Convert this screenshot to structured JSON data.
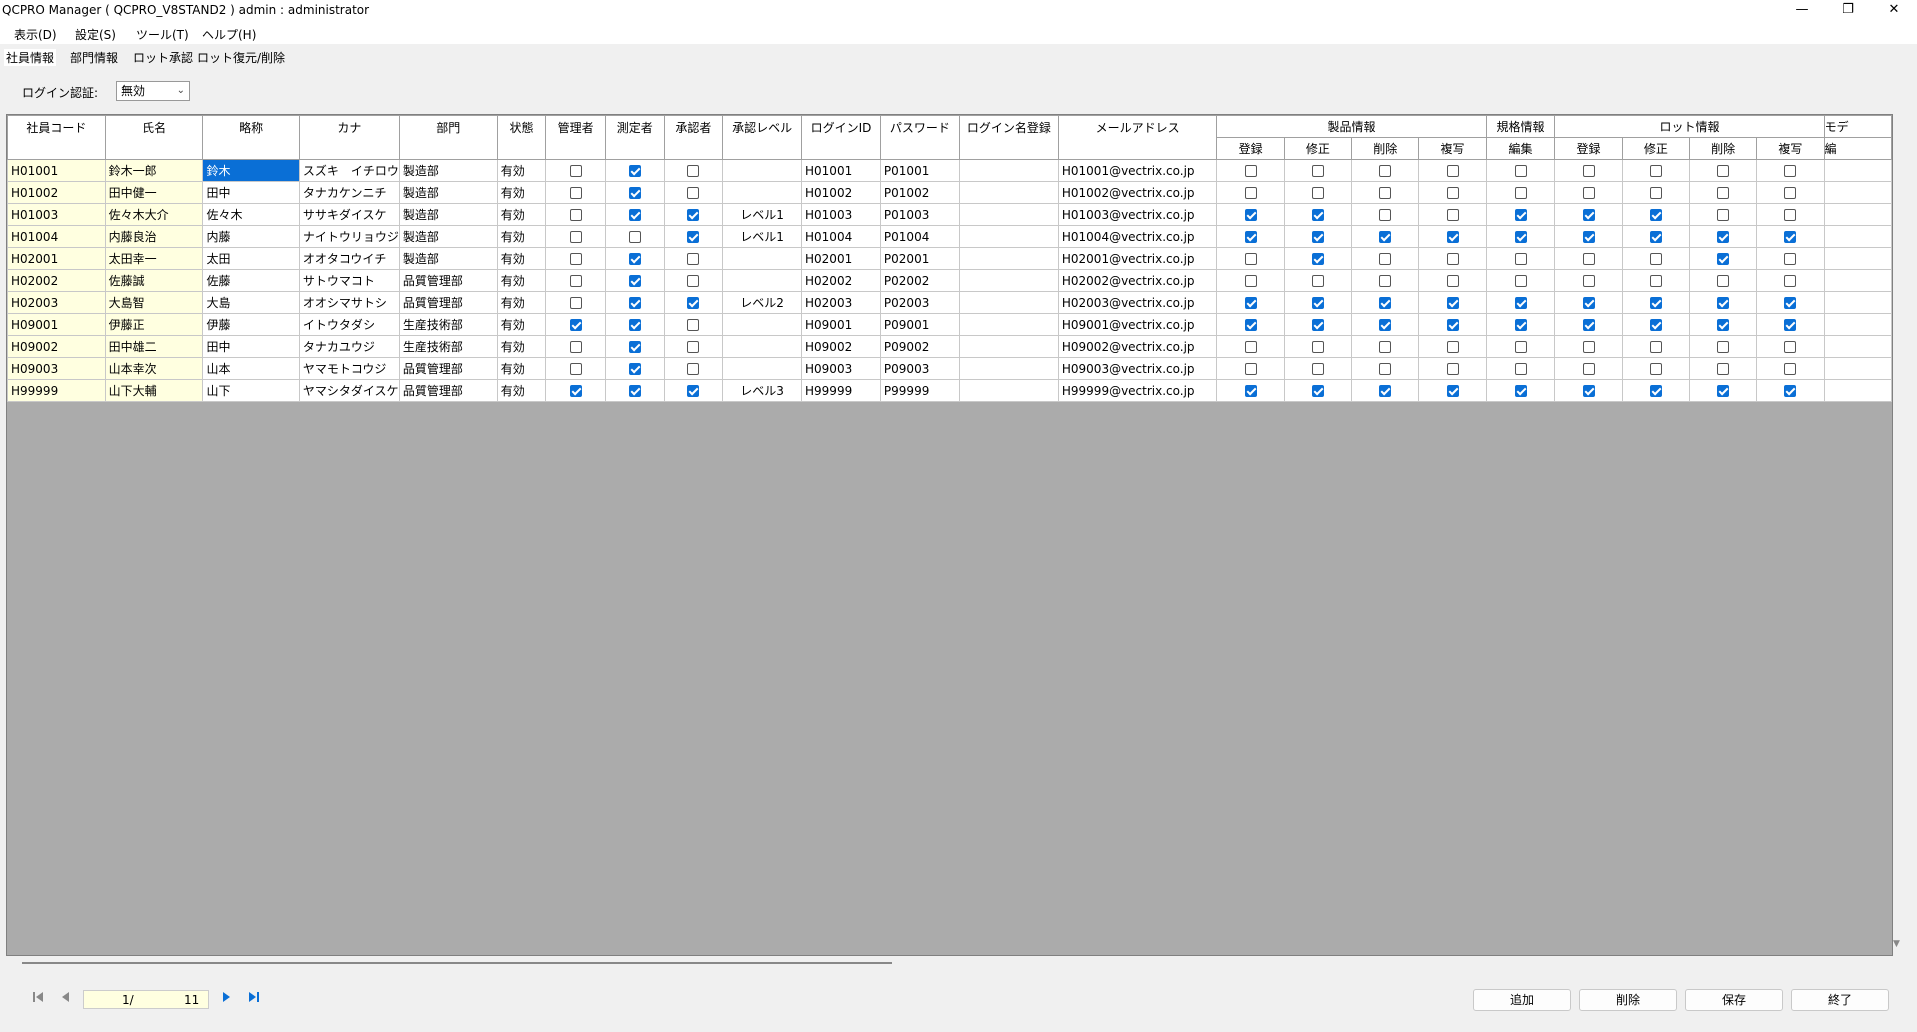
{
  "window": {
    "title": "QCPRO Manager ( QCPRO_V8STAND2 )    admin : administrator",
    "controls": {
      "minimize": "—",
      "maximize": "❐",
      "close": "✕"
    }
  },
  "menu": [
    "表示(D)",
    "設定(S)",
    "ツール(T)",
    "ヘルプ(H)"
  ],
  "tabs": [
    "社員情報",
    "部門情報",
    "ロット承認",
    "ロット復元/削除"
  ],
  "login": {
    "label": "ログイン認証:",
    "value": "無効"
  },
  "columns": {
    "code": "社員コード",
    "name": "氏名",
    "short": "略称",
    "kana": "カナ",
    "dept": "部門",
    "status": "状態",
    "admin": "管理者",
    "measurer": "測定者",
    "approver": "承認者",
    "approve_level": "承認レベル",
    "login_id": "ログインID",
    "password": "パスワード",
    "login_name": "ログイン名登録",
    "email": "メールアドレス",
    "groups": {
      "product": "製品情報",
      "spec": "規格情報",
      "lot": "ロット情報",
      "model": "モデ"
    },
    "sub": [
      "登録",
      "修正",
      "削除",
      "複写",
      "編集",
      "登録",
      "修正",
      "削除",
      "複写",
      "編"
    ]
  },
  "rows": [
    {
      "code": "H01001",
      "name": "鈴木一郎",
      "short": "鈴木",
      "kana": "スズキ　イチロウ",
      "dept": "製造部",
      "status": "有効",
      "admin": false,
      "measurer": true,
      "approver": false,
      "level": "",
      "login_id": "H01001",
      "password": "P01001",
      "login_name": "",
      "email": "H01001@vectrix.co.jp",
      "perms": [
        false,
        false,
        false,
        false,
        false,
        false,
        false,
        false,
        false
      ]
    },
    {
      "code": "H01002",
      "name": "田中健一",
      "short": "田中",
      "kana": "タナカケンニチ",
      "dept": "製造部",
      "status": "有効",
      "admin": false,
      "measurer": true,
      "approver": false,
      "level": "",
      "login_id": "H01002",
      "password": "P01002",
      "login_name": "",
      "email": "H01002@vectrix.co.jp",
      "perms": [
        false,
        false,
        false,
        false,
        false,
        false,
        false,
        false,
        false
      ]
    },
    {
      "code": "H01003",
      "name": "佐々木大介",
      "short": "佐々木",
      "kana": "ササキダイスケ",
      "dept": "製造部",
      "status": "有効",
      "admin": false,
      "measurer": true,
      "approver": true,
      "level": "レベル1",
      "login_id": "H01003",
      "password": "P01003",
      "login_name": "",
      "email": "H01003@vectrix.co.jp",
      "perms": [
        true,
        true,
        false,
        false,
        true,
        true,
        true,
        false,
        false
      ]
    },
    {
      "code": "H01004",
      "name": "内藤良治",
      "short": "内藤",
      "kana": "ナイトウリョウジ",
      "dept": "製造部",
      "status": "有効",
      "admin": false,
      "measurer": false,
      "approver": true,
      "level": "レベル1",
      "login_id": "H01004",
      "password": "P01004",
      "login_name": "",
      "email": "H01004@vectrix.co.jp",
      "perms": [
        true,
        true,
        true,
        true,
        true,
        true,
        true,
        true,
        true
      ]
    },
    {
      "code": "H02001",
      "name": "太田幸一",
      "short": "太田",
      "kana": "オオタコウイチ",
      "dept": "製造部",
      "status": "有効",
      "admin": false,
      "measurer": true,
      "approver": false,
      "level": "",
      "login_id": "H02001",
      "password": "P02001",
      "login_name": "",
      "email": "H02001@vectrix.co.jp",
      "perms": [
        false,
        true,
        false,
        false,
        false,
        false,
        false,
        true,
        false
      ]
    },
    {
      "code": "H02002",
      "name": "佐藤誠",
      "short": "佐藤",
      "kana": "サトウマコト",
      "dept": "品質管理部",
      "status": "有効",
      "admin": false,
      "measurer": true,
      "approver": false,
      "level": "",
      "login_id": "H02002",
      "password": "P02002",
      "login_name": "",
      "email": "H02002@vectrix.co.jp",
      "perms": [
        false,
        false,
        false,
        false,
        false,
        false,
        false,
        false,
        false
      ]
    },
    {
      "code": "H02003",
      "name": "大島智",
      "short": "大島",
      "kana": "オオシマサトシ",
      "dept": "品質管理部",
      "status": "有効",
      "admin": false,
      "measurer": true,
      "approver": true,
      "level": "レベル2",
      "login_id": "H02003",
      "password": "P02003",
      "login_name": "",
      "email": "H02003@vectrix.co.jp",
      "perms": [
        true,
        true,
        true,
        true,
        true,
        true,
        true,
        true,
        true
      ]
    },
    {
      "code": "H09001",
      "name": "伊藤正",
      "short": "伊藤",
      "kana": "イトウタダシ",
      "dept": "生産技術部",
      "status": "有効",
      "admin": true,
      "measurer": true,
      "approver": false,
      "level": "",
      "login_id": "H09001",
      "password": "P09001",
      "login_name": "",
      "email": "H09001@vectrix.co.jp",
      "perms": [
        true,
        true,
        true,
        true,
        true,
        true,
        true,
        true,
        true
      ]
    },
    {
      "code": "H09002",
      "name": "田中雄二",
      "short": "田中",
      "kana": "タナカユウジ",
      "dept": "生産技術部",
      "status": "有効",
      "admin": false,
      "measurer": true,
      "approver": false,
      "level": "",
      "login_id": "H09002",
      "password": "P09002",
      "login_name": "",
      "email": "H09002@vectrix.co.jp",
      "perms": [
        false,
        false,
        false,
        false,
        false,
        false,
        false,
        false,
        false
      ]
    },
    {
      "code": "H09003",
      "name": "山本幸次",
      "short": "山本",
      "kana": "ヤマモトコウジ",
      "dept": "品質管理部",
      "status": "有効",
      "admin": false,
      "measurer": true,
      "approver": false,
      "level": "",
      "login_id": "H09003",
      "password": "P09003",
      "login_name": "",
      "email": "H09003@vectrix.co.jp",
      "perms": [
        false,
        false,
        false,
        false,
        false,
        false,
        false,
        false,
        false
      ]
    },
    {
      "code": "H99999",
      "name": "山下大輔",
      "short": "山下",
      "kana": "ヤマシタダイスケ",
      "dept": "品質管理部",
      "status": "有効",
      "admin": true,
      "measurer": true,
      "approver": true,
      "level": "レベル3",
      "login_id": "H99999",
      "password": "P99999",
      "login_name": "",
      "email": "H99999@vectrix.co.jp",
      "perms": [
        true,
        true,
        true,
        true,
        true,
        true,
        true,
        true,
        true
      ]
    }
  ],
  "pager": {
    "current": "1/",
    "total": "11",
    "first_icon": "first-page-icon",
    "prev_icon": "prev-page-icon",
    "next_icon": "next-page-icon",
    "last_icon": "last-page-icon"
  },
  "buttons": {
    "add": "追加",
    "delete": "削除",
    "save": "保存",
    "exit": "終了"
  },
  "colors": {
    "selection": "#0a6fd6",
    "key_cell": "#ffffe0",
    "grid_bg": "#ababab"
  }
}
